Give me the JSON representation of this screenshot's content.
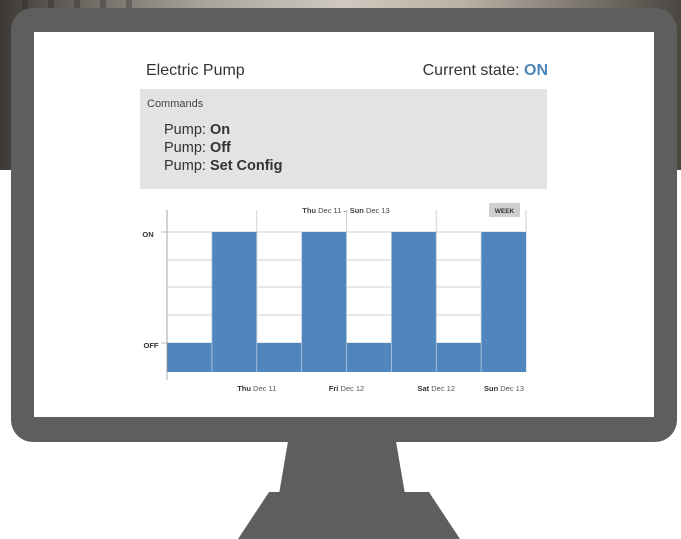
{
  "device": {
    "name": "Electric Pump",
    "state_label": "Current state:",
    "state_value": "ON"
  },
  "commands": {
    "title": "Commands",
    "items": [
      {
        "prefix": "Pump:",
        "action": "On"
      },
      {
        "prefix": "Pump:",
        "action": "Off"
      },
      {
        "prefix": "Pump:",
        "action": "Set Config"
      }
    ]
  },
  "range_button": "WEEK",
  "colors": {
    "accent": "#4a86b8",
    "bar": "#4f86bd",
    "panel": "#e3e3e3",
    "bezel": "#5e5e5e"
  },
  "chart_data": {
    "type": "bar",
    "title": {
      "start_day": "Thu",
      "start_date": "Dec 11",
      "sep": "–",
      "end_day": "Sun",
      "end_date": "Dec 13"
    },
    "y_levels": [
      "OFF",
      "ON"
    ],
    "ylim": [
      0,
      1
    ],
    "values": [
      0,
      1,
      0,
      1,
      0,
      1,
      0,
      1
    ],
    "x_ticks": [
      {
        "day": "Thu",
        "date": "Dec 11"
      },
      {
        "day": "Fri",
        "date": "Dec 12"
      },
      {
        "day": "Sat",
        "date": "Dec 12"
      },
      {
        "day": "Sun",
        "date": "Dec 13"
      }
    ],
    "grid": true
  }
}
